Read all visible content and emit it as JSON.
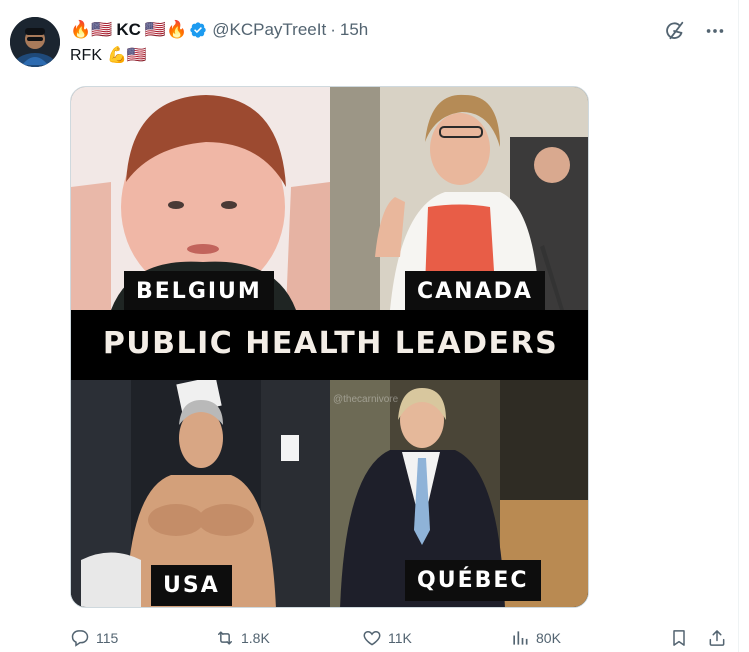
{
  "tweet": {
    "author": {
      "name": "KC",
      "handle": "@KCPayTreeIt",
      "avatar_icon": "avatar-photo",
      "name_prefix_emojis": "🔥🇺🇸",
      "name_suffix_emojis": "🇺🇸🔥"
    },
    "separator": "·",
    "time": "15h",
    "text": "RFK",
    "text_emojis": "💪🇺🇸",
    "verified_color": "#1d9bf0"
  },
  "meme": {
    "banner": "PUBLIC HEALTH LEADERS",
    "panels": [
      {
        "label": "BELGIUM"
      },
      {
        "label": "CANADA"
      },
      {
        "label": "USA"
      },
      {
        "label": "QUÉBEC"
      }
    ],
    "watermark": "@thecarnivore"
  },
  "actions": {
    "replies": "115",
    "reposts": "1.8K",
    "likes": "11K",
    "views": "80K"
  }
}
